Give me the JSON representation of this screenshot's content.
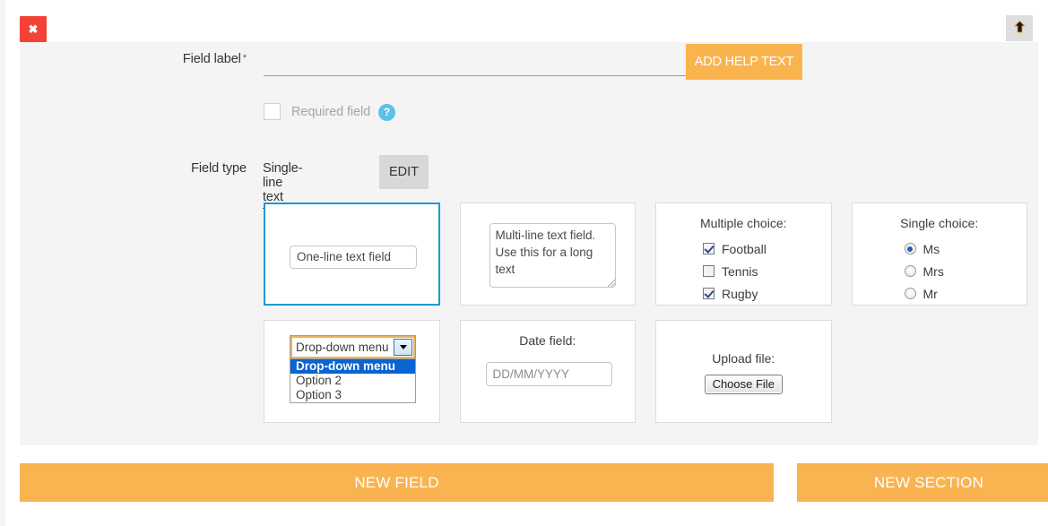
{
  "colors": {
    "accent_orange": "#f9b44e",
    "button_orange": "#fab351",
    "close_red": "#f44336",
    "selected_blue": "#1b9ad6",
    "help_blue": "#5bc0ea",
    "panel_grey": "#f4f4f4",
    "edit_grey": "#d8d8d8",
    "option_highlight_blue": "#0a64d2"
  },
  "toolbar": {
    "close_label": "✖",
    "close_icon": "close-icon",
    "move_up_icon": "arrow-up-icon"
  },
  "form": {
    "field_label": {
      "label": "Field label",
      "required_marker": "*",
      "input_value": "",
      "input_placeholder": ""
    },
    "add_help_text_label": "ADD HELP TEXT",
    "required_field": {
      "label": "Required field",
      "checked": false,
      "help_icon_label": "?"
    },
    "field_type": {
      "label": "Field type",
      "value": "Single-line text field",
      "edit_label": "EDIT"
    }
  },
  "type_cards": [
    {
      "name": "single-line-text-field",
      "selected": true,
      "title": "",
      "preview": {
        "kind": "text-input",
        "value": "One-line text field"
      }
    },
    {
      "name": "multi-line-text-field",
      "selected": false,
      "title": "",
      "preview": {
        "kind": "textarea",
        "value": "Multi-line text field. Use this for a long text"
      }
    },
    {
      "name": "multiple-choice-field",
      "selected": false,
      "title": "Multiple choice:",
      "preview": {
        "kind": "checkboxes",
        "options": [
          {
            "label": "Football",
            "checked": true
          },
          {
            "label": "Tennis",
            "checked": false
          },
          {
            "label": "Rugby",
            "checked": true
          }
        ]
      }
    },
    {
      "name": "single-choice-field",
      "selected": false,
      "title": "Single choice:",
      "preview": {
        "kind": "radios",
        "options": [
          {
            "label": "Ms",
            "checked": true
          },
          {
            "label": "Mrs",
            "checked": false
          },
          {
            "label": "Mr",
            "checked": false
          }
        ]
      }
    },
    {
      "name": "drop-down-menu-field",
      "selected": false,
      "title": "",
      "preview": {
        "kind": "select-open",
        "value": "Drop-down menu",
        "options": [
          "Drop-down menu",
          "Option 2",
          "Option 3"
        ],
        "highlighted_index": 0
      }
    },
    {
      "name": "date-field",
      "selected": false,
      "title": "Date field:",
      "preview": {
        "kind": "date-input",
        "placeholder": "DD/MM/YYYY"
      }
    },
    {
      "name": "upload-file-field",
      "selected": false,
      "title": "Upload file:",
      "preview": {
        "kind": "file-input",
        "button_label": "Choose File"
      }
    }
  ],
  "actions": {
    "new_field_label": "NEW FIELD",
    "new_section_label": "NEW SECTION"
  }
}
